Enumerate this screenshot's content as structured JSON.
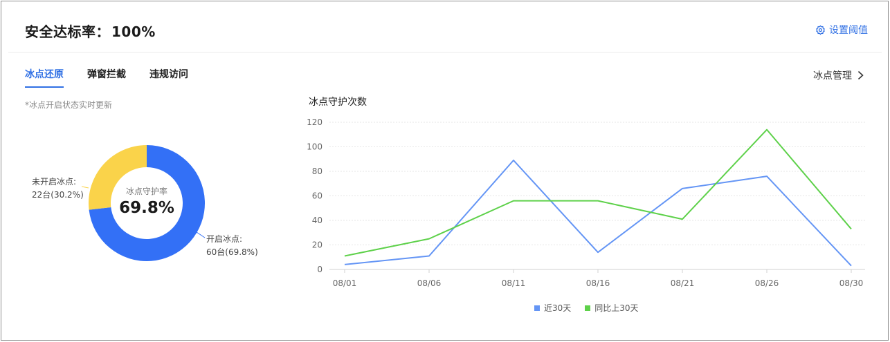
{
  "header": {
    "title_label": "安全达标率：",
    "title_value": "100%",
    "settings_label": "设置阈值"
  },
  "tabs": [
    {
      "label": "冰点还原",
      "active": true
    },
    {
      "label": "弹窗拦截",
      "active": false
    },
    {
      "label": "违规访问",
      "active": false
    }
  ],
  "manage_link": "冰点管理",
  "note": "*冰点开启状态实时更新",
  "donut": {
    "center_label": "冰点守护率",
    "center_value": "69.8%",
    "segments": [
      {
        "label": "开启冰点:",
        "detail": "60台(69.8%)",
        "value": 60,
        "color": "#3370f6"
      },
      {
        "label": "未开启冰点:",
        "detail": "22台(30.2%)",
        "value": 22,
        "color": "#fad34a"
      }
    ]
  },
  "chart_data": {
    "type": "line",
    "title": "冰点守护次数",
    "x": [
      "08/01",
      "08/06",
      "08/11",
      "08/16",
      "08/21",
      "08/26",
      "08/30"
    ],
    "yticks": [
      0,
      20,
      40,
      60,
      80,
      100,
      120
    ],
    "ylim": [
      0,
      120
    ],
    "grid": true,
    "legend": "bottom",
    "series": [
      {
        "name": "近30天",
        "color": "#6495f5",
        "values": [
          4,
          11,
          89,
          14,
          66,
          76,
          3
        ]
      },
      {
        "name": "同比上30天",
        "color": "#5ed14a",
        "values": [
          11,
          25,
          56,
          56,
          41,
          114,
          33
        ]
      }
    ]
  }
}
